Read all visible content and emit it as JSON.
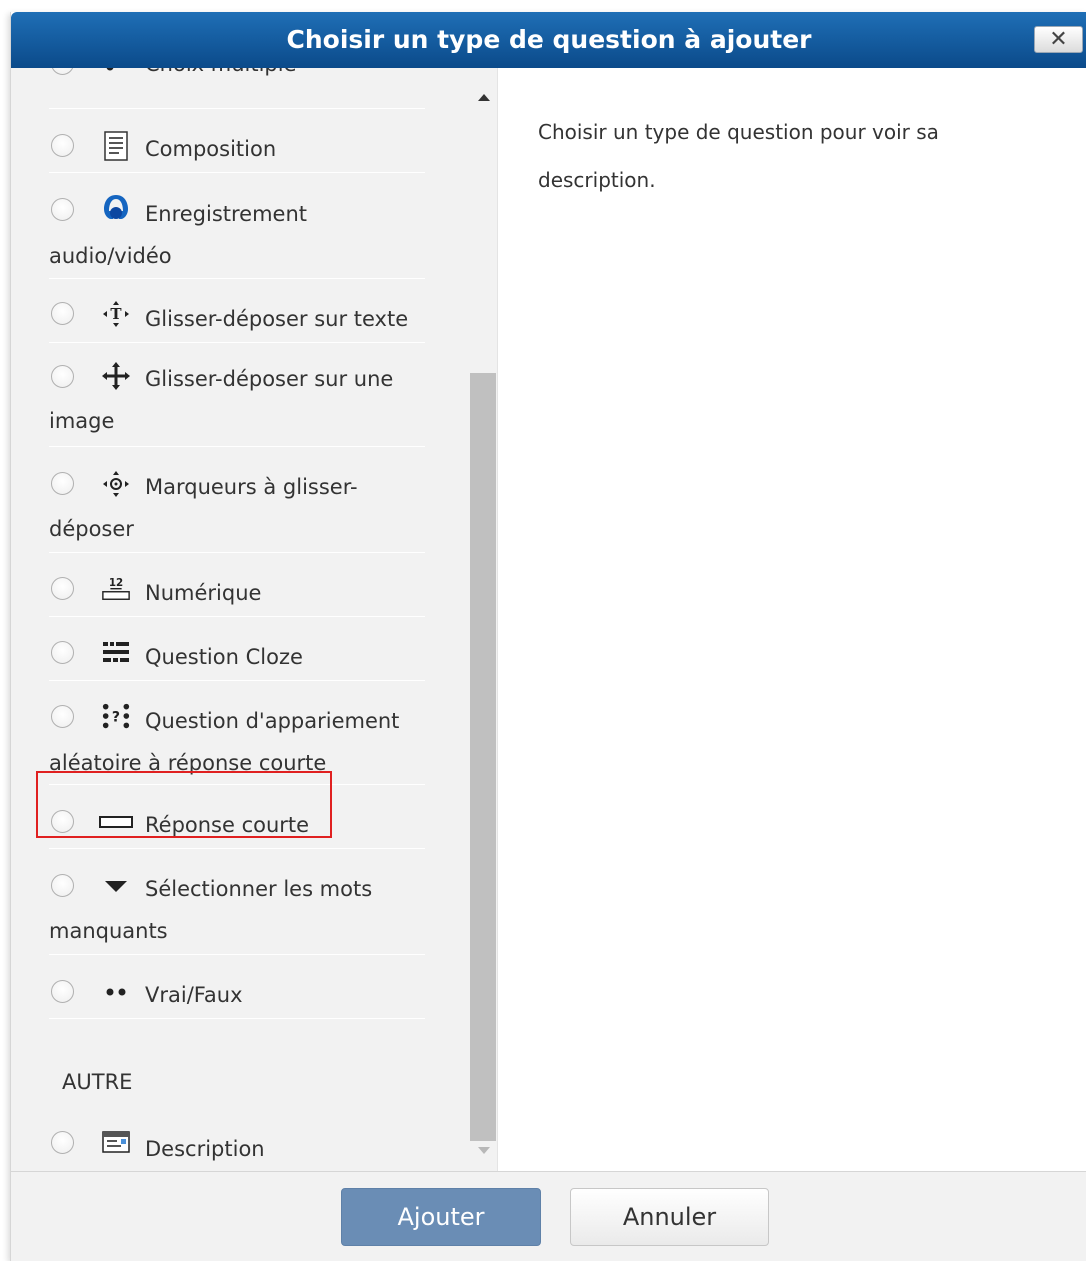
{
  "dialog": {
    "title": "Choisir un type de question à ajouter",
    "close_label": "✕"
  },
  "question_types": [
    {
      "label": "Choix multiple",
      "icon": "multichoice-icon"
    },
    {
      "label": "Composition",
      "icon": "essay-icon"
    },
    {
      "label": "Enregistrement audio/vidéo",
      "icon": "recording-icon"
    },
    {
      "label": "Glisser-déposer sur texte",
      "icon": "ddwtos-icon"
    },
    {
      "label": "Glisser-déposer sur une image",
      "icon": "ddimageortext-icon"
    },
    {
      "label": "Marqueurs à glisser-déposer",
      "icon": "ddmarker-icon"
    },
    {
      "label": "Numérique",
      "icon": "numerical-icon"
    },
    {
      "label": "Question Cloze",
      "icon": "cloze-icon"
    },
    {
      "label": "Question d'appariement aléatoire à réponse courte",
      "icon": "randomsamatch-icon"
    },
    {
      "label": "Réponse courte",
      "icon": "shortanswer-icon"
    },
    {
      "label": "Sélectionner les mots manquants",
      "icon": "gapselect-icon"
    },
    {
      "label": "Vrai/Faux",
      "icon": "truefalse-icon"
    }
  ],
  "other_section": {
    "heading": "AUTRE",
    "items": [
      {
        "label": "Description",
        "icon": "description-icon"
      }
    ]
  },
  "description_panel": {
    "text": "Choisir un type de question pour voir sa description."
  },
  "footer": {
    "add_label": "Ajouter",
    "cancel_label": "Annuler"
  },
  "colors": {
    "title_bar": "#0b4a8a",
    "add_button": "#6a8db5",
    "highlight": "#e02020"
  }
}
